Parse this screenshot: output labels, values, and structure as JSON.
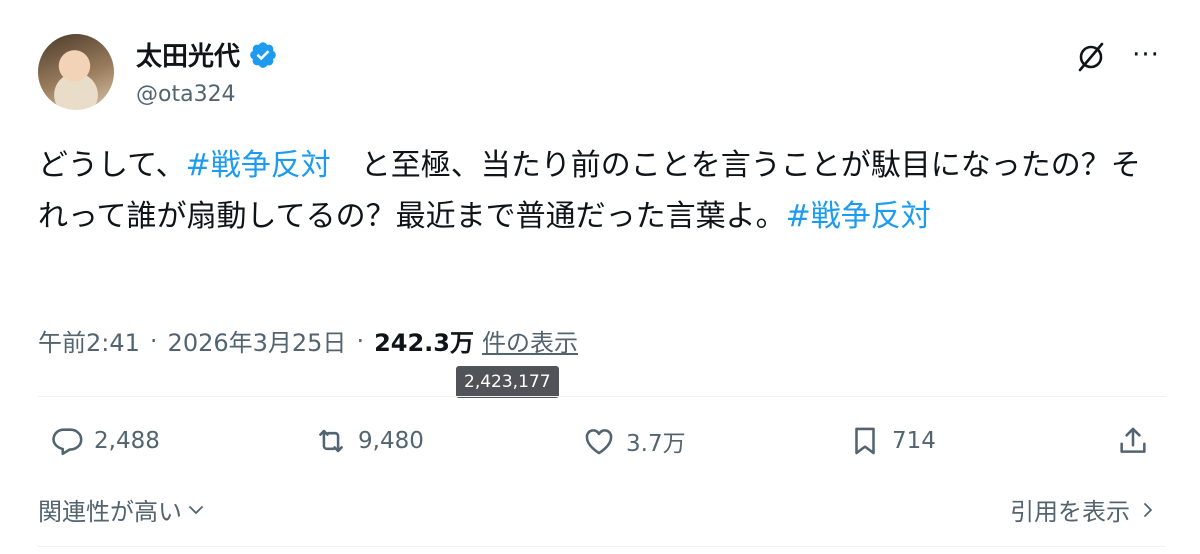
{
  "author": {
    "name": "太田光代",
    "handle": "@ota324",
    "verified": true,
    "verified_color": "#1d9bf0"
  },
  "header_icons": [
    "grok-icon",
    "more-icon"
  ],
  "tweet": {
    "segments": [
      {
        "text": "どうして、",
        "type": "text"
      },
      {
        "text": "#戦争反対",
        "type": "hashtag"
      },
      {
        "text": "　と至極、当たり前のことを言うことが駄目になったの？それって誰が扇動してるの？最近まで普通だった言葉よ。",
        "type": "text"
      },
      {
        "text": "#戦争反対",
        "type": "hashtag"
      }
    ]
  },
  "meta": {
    "time": "午前2:41",
    "date": "2026年3月25日",
    "views_count": "242.3万",
    "views_label": "件の表示",
    "views_tooltip": "2,423,177"
  },
  "actions": {
    "replies": "2,488",
    "retweets": "9,480",
    "likes": "3.7万",
    "bookmarks": "714"
  },
  "footer": {
    "sort_label": "関連性が高い",
    "quotes_label": "引用を表示"
  },
  "colors": {
    "text": "#0f1419",
    "secondary": "#536471",
    "link": "#1d9bf0",
    "divider": "#eff3f4"
  }
}
